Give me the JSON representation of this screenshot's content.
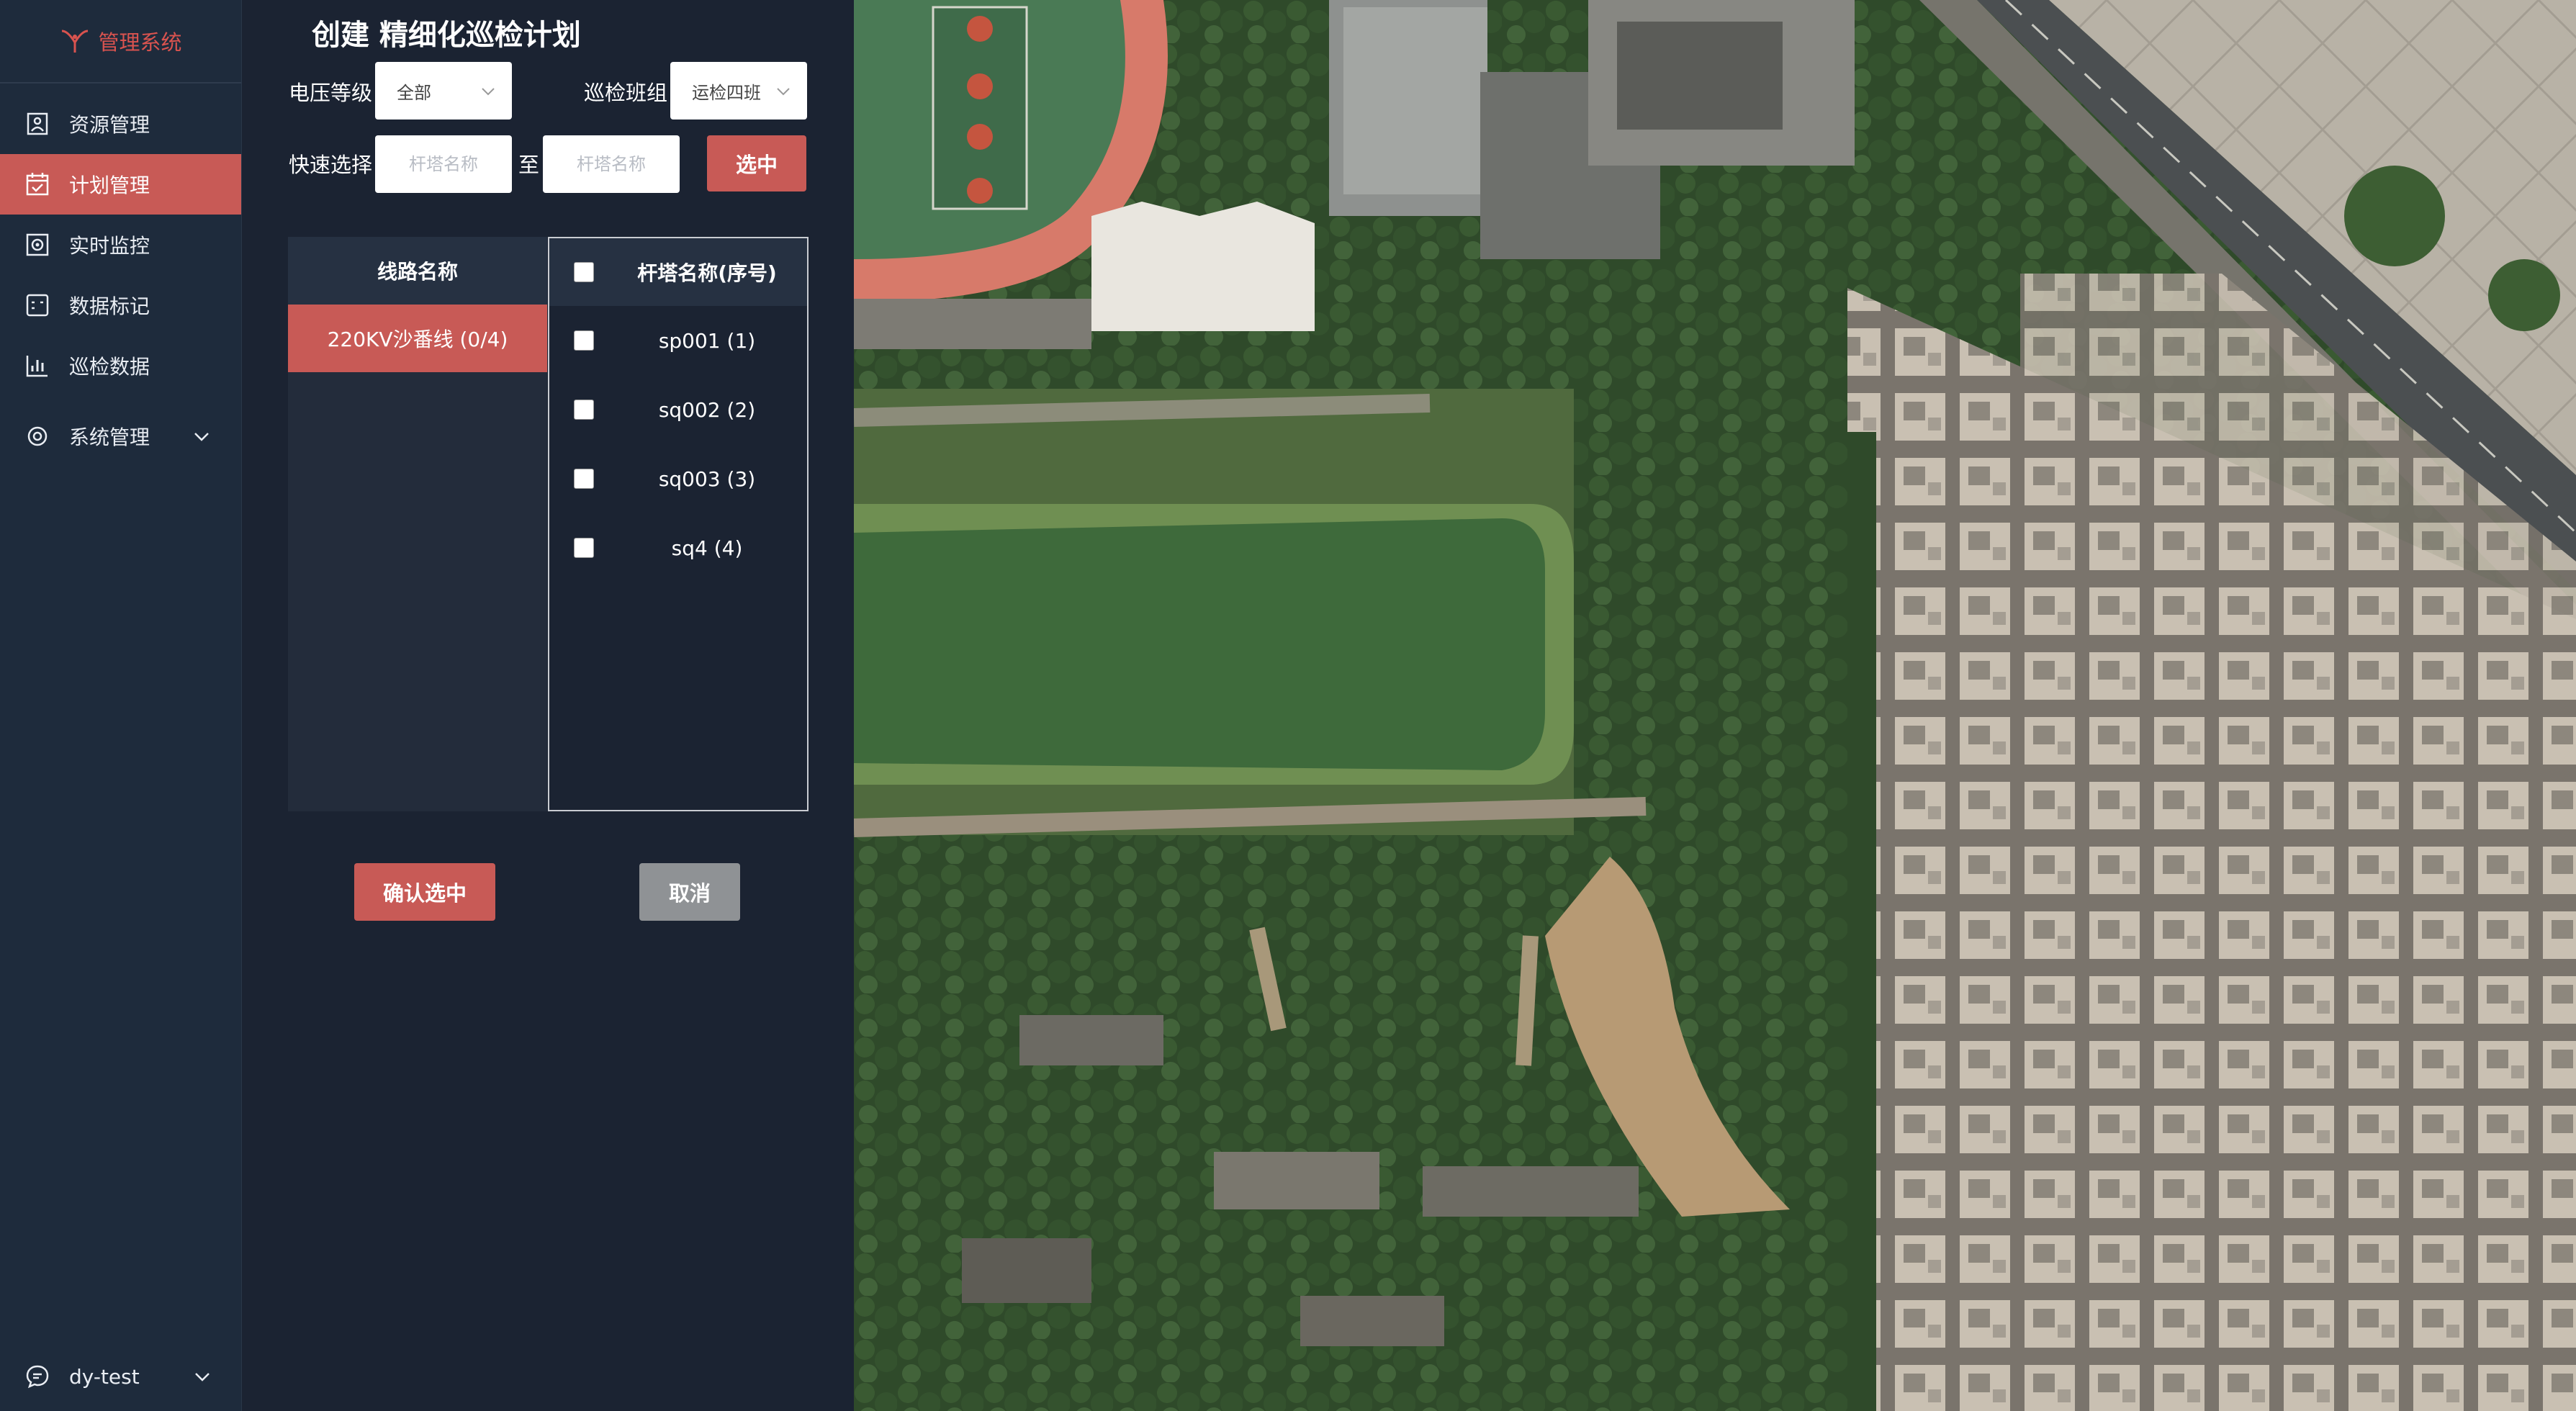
{
  "app": {
    "title": "管理系统"
  },
  "sidebar": {
    "items": [
      {
        "label": "资源管理",
        "icon": "resource-icon",
        "active": false
      },
      {
        "label": "计划管理",
        "icon": "calendar-icon",
        "active": true
      },
      {
        "label": "实时监控",
        "icon": "monitor-icon",
        "active": false
      },
      {
        "label": "数据标记",
        "icon": "data-mark-icon",
        "active": false
      },
      {
        "label": "巡检数据",
        "icon": "bar-chart-icon",
        "active": false
      },
      {
        "label": "系统管理",
        "icon": "gear-icon",
        "active": false,
        "expandable": true
      }
    ],
    "user": "dy-test"
  },
  "form": {
    "title": "创建 精细化巡检计划",
    "voltage_label": "电压等级",
    "voltage_value": "全部",
    "team_label": "巡检班组",
    "team_value": "运检四班",
    "quick_label": "快速选择",
    "from_placeholder": "杆塔名称",
    "to_label": "至",
    "to_placeholder": "杆塔名称",
    "select_button": "选中"
  },
  "lines_table": {
    "header": "线路名称",
    "rows": [
      "220KV沙番线 (0/4)"
    ]
  },
  "towers_table": {
    "header": "杆塔名称(序号)",
    "rows": [
      "sp001 (1)",
      "sq002 (2)",
      "sq003 (3)",
      "sq4 (4)"
    ]
  },
  "actions": {
    "confirm": "确认选中",
    "cancel": "取消"
  },
  "colors": {
    "accent": "#c85a56",
    "sidebar_bg": "#1e2b3c",
    "panel_bg": "#1b2332"
  }
}
